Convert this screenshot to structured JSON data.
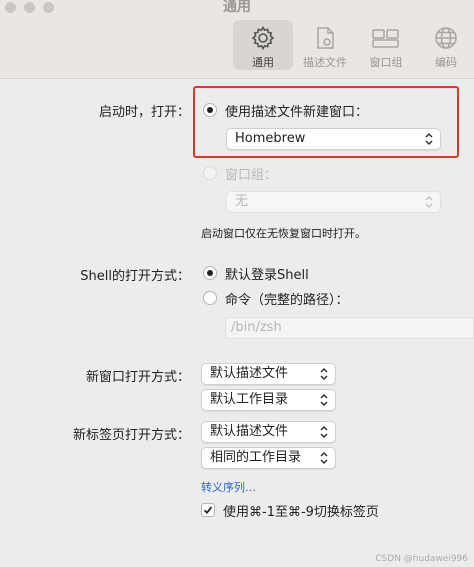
{
  "window": {
    "title": "通用"
  },
  "toolbar": {
    "items": [
      {
        "label": "通用",
        "icon": "gear-icon",
        "active": true
      },
      {
        "label": "描述文件",
        "icon": "profile-icon",
        "active": false
      },
      {
        "label": "窗口组",
        "icon": "window-group-icon",
        "active": false
      },
      {
        "label": "编码",
        "icon": "globe-icon",
        "active": false
      }
    ]
  },
  "startup": {
    "label": "启动时，打开：",
    "option_profile": "使用描述文件新建窗口：",
    "profile_value": "Homebrew",
    "option_group": "窗口组：",
    "group_value": "无",
    "note": "启动窗口仅在无恢复窗口时打开。"
  },
  "shell": {
    "label": "Shell的打开方式：",
    "option_default": "默认登录Shell",
    "option_command": "命令（完整的路径）：",
    "command_placeholder": "/bin/zsh"
  },
  "new_window": {
    "label": "新窗口打开方式：",
    "profile_value": "默认描述文件",
    "dir_value": "默认工作目录"
  },
  "new_tab": {
    "label": "新标签页打开方式：",
    "profile_value": "默认描述文件",
    "dir_value": "相同的工作目录",
    "shift_link": "转义序列…"
  },
  "tab_switch": {
    "label": "使用⌘-1至⌘-9切换标签页",
    "checked": true
  },
  "watermark": "CSDN @hudawei996",
  "colors": {
    "highlight": "#e0362c",
    "link": "#2a62c9"
  }
}
